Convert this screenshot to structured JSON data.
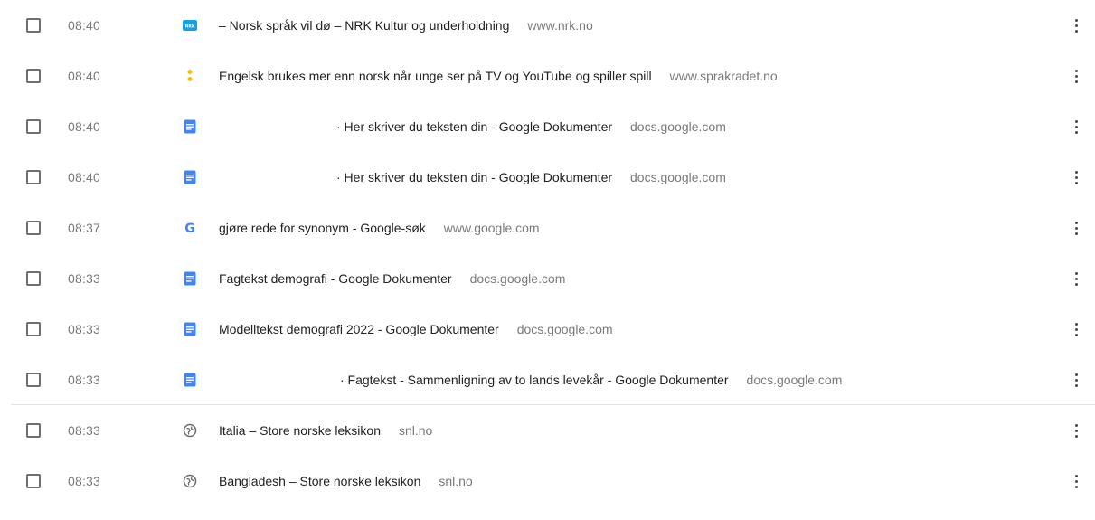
{
  "history": {
    "items": [
      {
        "time": "08:40",
        "title": "– Norsk språk vil dø – NRK Kultur og underholdning",
        "domain": "www.nrk.no",
        "favicon": "nrk-icon",
        "favicon_text": "NRK"
      },
      {
        "time": "08:40",
        "title": "Engelsk brukes mer enn norsk når unge ser på TV og YouTube og spiller spill",
        "domain": "www.sprakradet.no",
        "favicon": "sprakradet-icon"
      },
      {
        "time": "08:40",
        "title": "· Her skriver du teksten din - Google Dokumenter",
        "domain": "docs.google.com",
        "favicon": "google-docs-icon"
      },
      {
        "time": "08:40",
        "title": "· Her skriver du teksten din - Google Dokumenter",
        "domain": "docs.google.com",
        "favicon": "google-docs-icon"
      },
      {
        "time": "08:37",
        "title": "gjøre rede for synonym - Google-søk",
        "domain": "www.google.com",
        "favicon": "google-icon",
        "favicon_text": "G"
      },
      {
        "time": "08:33",
        "title": "Fagtekst demografi - Google Dokumenter",
        "domain": "docs.google.com",
        "favicon": "google-docs-icon"
      },
      {
        "time": "08:33",
        "title": "Modelltekst demografi 2022 - Google Dokumenter",
        "domain": "docs.google.com",
        "favicon": "google-docs-icon"
      },
      {
        "time": "08:33",
        "title": "· Fagtekst - Sammenligning av to lands levekår - Google Dokumenter",
        "domain": "docs.google.com",
        "favicon": "google-docs-icon"
      },
      {
        "time": "08:33",
        "title": "Italia – Store norske leksikon",
        "domain": "snl.no",
        "favicon": "globe-icon"
      },
      {
        "time": "08:33",
        "title": "Bangladesh – Store norske leksikon",
        "domain": "snl.no",
        "favicon": "globe-icon"
      }
    ]
  },
  "colors": {
    "nrk_blue": "#1a9fe0",
    "sprakradet_yellow": "#f2c200",
    "docs_blue": "#4285f4",
    "google_blue": "#4285f4",
    "google_red": "#ea4335",
    "google_yellow": "#fbbc05",
    "google_green": "#34a853",
    "text_primary": "#202124",
    "text_secondary": "#7a7a7a"
  }
}
